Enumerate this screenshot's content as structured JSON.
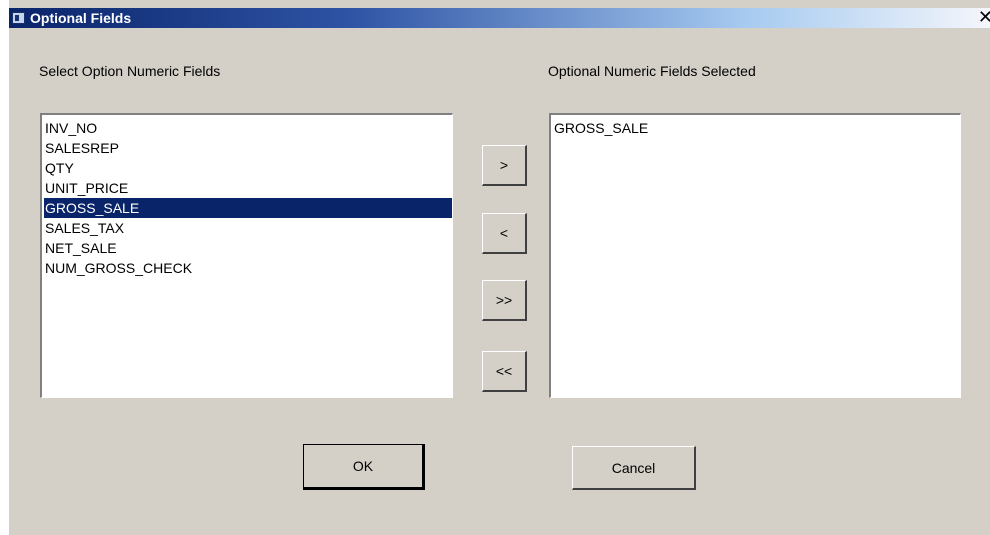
{
  "window": {
    "title": "Optional Fields",
    "close_glyph": "✕"
  },
  "left": {
    "label": "Select Option Numeric Fields",
    "items": [
      "INV_NO",
      "SALESREP",
      "QTY",
      "UNIT_PRICE",
      "GROSS_SALE",
      "SALES_TAX",
      "NET_SALE",
      "NUM_GROSS_CHECK"
    ],
    "selected_index": 4
  },
  "right": {
    "label": "Optional Numeric Fields Selected",
    "items": [
      "GROSS_SALE"
    ]
  },
  "transfer_buttons": {
    "add": ">",
    "remove": "<",
    "add_all": ">>",
    "remove_all": "<<"
  },
  "footer": {
    "ok": "OK",
    "cancel": "Cancel"
  },
  "colors": {
    "dialog_bg": "#d4d0c8",
    "selection": "#0a246a",
    "title_start": "#0a246a",
    "title_end": "#a6caf0"
  }
}
